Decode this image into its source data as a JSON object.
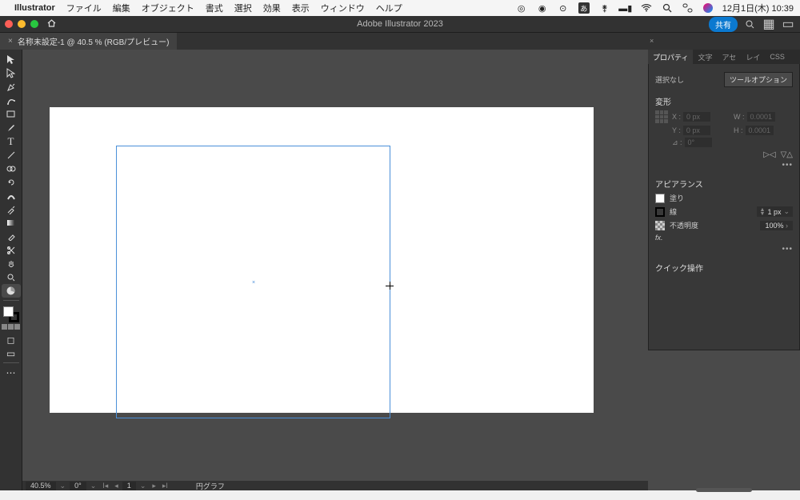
{
  "menubar": {
    "appname": "Illustrator",
    "items": [
      "ファイル",
      "編集",
      "オブジェクト",
      "書式",
      "選択",
      "効果",
      "表示",
      "ウィンドウ",
      "ヘルプ"
    ],
    "datetime": "12月1日(木)  10:39"
  },
  "appbar": {
    "title": "Adobe Illustrator 2023",
    "share": "共有"
  },
  "tab": {
    "label": "名称未設定-1 @ 40.5 % (RGB/プレビュー)"
  },
  "status": {
    "zoom": "40.5%",
    "rotate": "0°",
    "artboard_index": "1",
    "tool": "円グラフ"
  },
  "panel": {
    "tabs": [
      "プロパティ",
      "文字",
      "アセ",
      "レイ",
      "CSS"
    ],
    "selection_label": "選択なし",
    "tool_options": "ツールオプション",
    "transform_label": "変形",
    "x_label": "X :",
    "y_label": "Y :",
    "w_label": "W :",
    "h_label": "H :",
    "x_val": "0 px",
    "y_val": "0 px",
    "w_val": "0.0001",
    "h_val": "0.0001",
    "angle_label": "⊿ :",
    "angle_val": "0°",
    "appearance_label": "アピアランス",
    "fill_label": "塗り",
    "stroke_label": "線",
    "stroke_val": "1 px",
    "opacity_label": "不透明度",
    "opacity_val": "100%",
    "fx_label": "fx.",
    "quick_label": "クイック操作"
  }
}
